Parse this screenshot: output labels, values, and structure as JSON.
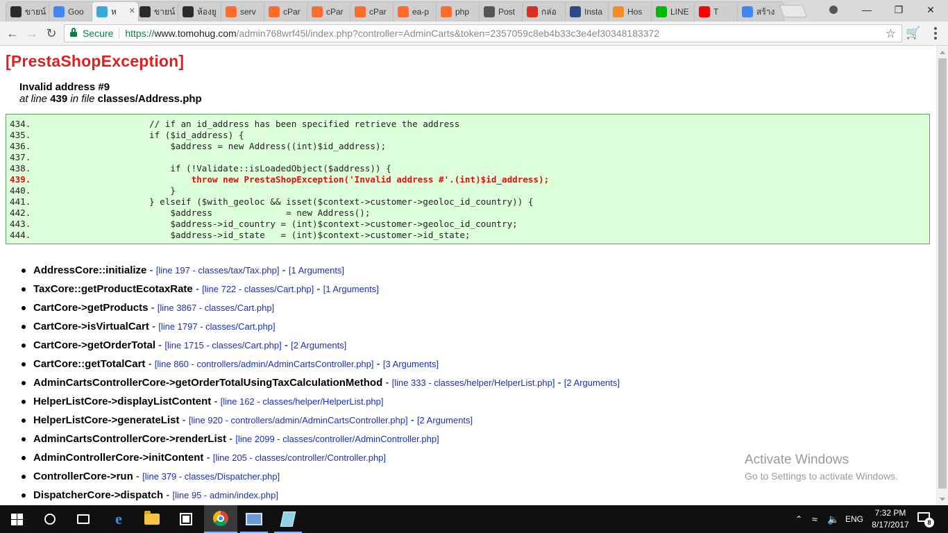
{
  "browser": {
    "tabs": [
      {
        "label": "ขายน์",
        "icon": "terminal-icon",
        "color": "#2b2b2b"
      },
      {
        "label": "Goo",
        "icon": "google-translate-icon",
        "color": "#4285f4"
      },
      {
        "label": "ห",
        "icon": "prestashop-icon",
        "color": "#3aa9d8"
      },
      {
        "label": "ขายน์",
        "icon": "terminal-icon",
        "color": "#2b2b2b"
      },
      {
        "label": "ห้องยู",
        "icon": "terminal-icon",
        "color": "#2b2b2b"
      },
      {
        "label": "serv",
        "icon": "cpanel-icon",
        "color": "#ff6c2c"
      },
      {
        "label": "cPar",
        "icon": "cpanel-icon",
        "color": "#ff6c2c"
      },
      {
        "label": "cPar",
        "icon": "cpanel-icon",
        "color": "#ff6c2c"
      },
      {
        "label": "cPar",
        "icon": "cpanel-icon",
        "color": "#ff6c2c"
      },
      {
        "label": "ea-p",
        "icon": "cpanel-icon",
        "color": "#ff6c2c"
      },
      {
        "label": "php",
        "icon": "cpanel-icon",
        "color": "#ff6c2c"
      },
      {
        "label": "Post",
        "icon": "postman-icon",
        "color": "#555555"
      },
      {
        "label": "กล่อ",
        "icon": "gmail-icon",
        "color": "#d93025"
      },
      {
        "label": "Insta",
        "icon": "tools-icon",
        "color": "#2a4a8a"
      },
      {
        "label": "Hos",
        "icon": "hostgator-icon",
        "color": "#f28c28"
      },
      {
        "label": "LINE",
        "icon": "line-icon",
        "color": "#00b900"
      },
      {
        "label": "T",
        "icon": "youtube-icon",
        "color": "#ff0000"
      },
      {
        "label": "สร้าง",
        "icon": "google-icon",
        "color": "#4285f4"
      }
    ],
    "address": {
      "secure_label": "Secure",
      "scheme": "https://",
      "host": "www.tomohug.com",
      "path": "/admin768wrf45l/index.php?controller=AdminCarts&token=2357059c8eb4b33c3e4ef30348183372"
    }
  },
  "exception": {
    "title": "[PrestaShopException]",
    "message": "Invalid address #9",
    "at_line_prefix": "at line",
    "line": "439",
    "in_file_label": "in file",
    "file": "classes/Address.php"
  },
  "code_lines": [
    {
      "n": "434.",
      "code": "            // if an id_address has been specified retrieve the address"
    },
    {
      "n": "435.",
      "code": "            if ($id_address) {"
    },
    {
      "n": "436.",
      "code": "                $address = new Address((int)$id_address);"
    },
    {
      "n": "437.",
      "code": ""
    },
    {
      "n": "438.",
      "code": "                if (!Validate::isLoadedObject($address)) {"
    },
    {
      "n": "439.",
      "code": "                    throw new PrestaShopException('Invalid address #'.(int)$id_address);",
      "highlight": true
    },
    {
      "n": "440.",
      "code": "                }"
    },
    {
      "n": "441.",
      "code": "            } elseif ($with_geoloc && isset($context->customer->geoloc_id_country)) {"
    },
    {
      "n": "442.",
      "code": "                $address              = new Address();"
    },
    {
      "n": "443.",
      "code": "                $address->id_country = (int)$context->customer->geoloc_id_country;"
    },
    {
      "n": "444.",
      "code": "                $address->id_state   = (int)$context->customer->id_state;"
    }
  ],
  "trace": [
    {
      "fn": "AddressCore::initialize",
      "loc": "[line 197 - classes/tax/Tax.php]",
      "args": "[1 Arguments]"
    },
    {
      "fn": "TaxCore::getProductEcotaxRate",
      "loc": "[line 722 - classes/Cart.php]",
      "args": "[1 Arguments]"
    },
    {
      "fn": "CartCore->getProducts",
      "loc": "[line 3867 - classes/Cart.php]",
      "args": ""
    },
    {
      "fn": "CartCore->isVirtualCart",
      "loc": "[line 1797 - classes/Cart.php]",
      "args": ""
    },
    {
      "fn": "CartCore->getOrderTotal",
      "loc": "[line 1715 - classes/Cart.php]",
      "args": "[2 Arguments]"
    },
    {
      "fn": "CartCore::getTotalCart",
      "loc": "[line 860 - controllers/admin/AdminCartsController.php]",
      "args": "[3 Arguments]"
    },
    {
      "fn": "AdminCartsControllerCore->getOrderTotalUsingTaxCalculationMethod",
      "loc": "[line 333 - classes/helper/HelperList.php]",
      "args": "[2 Arguments]"
    },
    {
      "fn": "HelperListCore->displayListContent",
      "loc": "[line 162 - classes/helper/HelperList.php]",
      "args": ""
    },
    {
      "fn": "HelperListCore->generateList",
      "loc": "[line 920 - controllers/admin/AdminCartsController.php]",
      "args": "[2 Arguments]"
    },
    {
      "fn": "AdminCartsControllerCore->renderList",
      "loc": "[line 2099 - classes/controller/AdminController.php]",
      "args": ""
    },
    {
      "fn": "AdminControllerCore->initContent",
      "loc": "[line 205 - classes/controller/Controller.php]",
      "args": ""
    },
    {
      "fn": "ControllerCore->run",
      "loc": "[line 379 - classes/Dispatcher.php]",
      "args": ""
    },
    {
      "fn": "DispatcherCore->dispatch",
      "loc": "[line 95 - admin/index.php]",
      "args": ""
    }
  ],
  "watermark": {
    "title": "Activate Windows",
    "subtitle": "Go to Settings to activate Windows."
  },
  "taskbar": {
    "language": "ENG",
    "time": "7:32 PM",
    "date": "8/17/2017",
    "notification_count": "8"
  }
}
